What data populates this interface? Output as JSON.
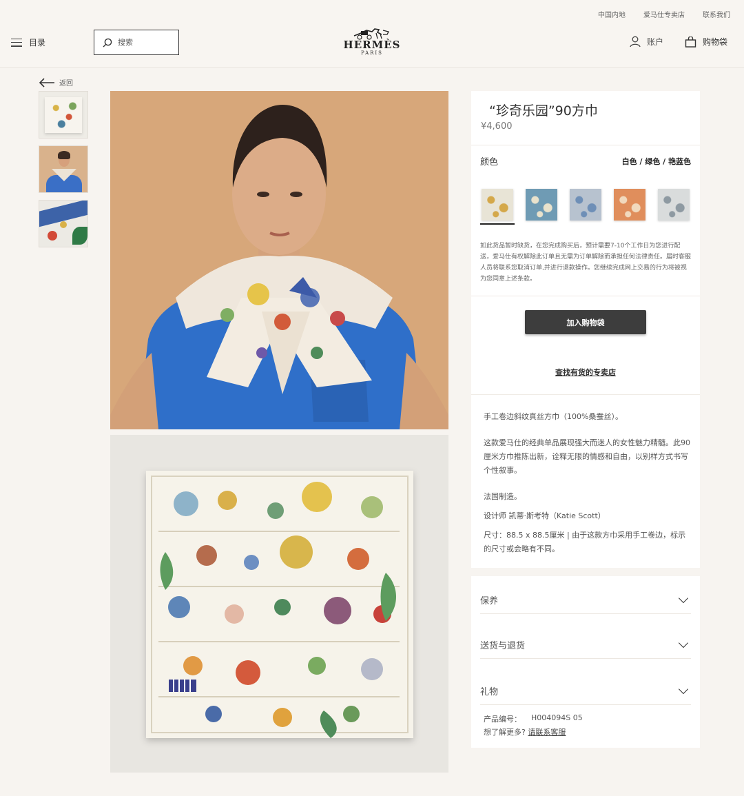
{
  "header": {
    "util_links": [
      "中国内地",
      "爱马仕专卖店",
      "联系我们"
    ],
    "menu_label": "目录",
    "search_placeholder": "搜索",
    "brand": "HERMÈS",
    "brand_city": "PARIS",
    "account_label": "账户",
    "bag_label": "购物袋"
  },
  "nav": {
    "back_label": "返回"
  },
  "product": {
    "title": "“珍奇乐园”90方巾",
    "price": "¥4,600",
    "color_label": "颜色",
    "color_value": "白色 / 绿色 / 艳蓝色",
    "swatches": [
      {
        "name": "白色 / 绿色 / 艳蓝色",
        "color": "#e8e4d6",
        "accent": "#d4a84a",
        "active": true
      },
      {
        "name": "swatch-2",
        "color": "#6f9bb4",
        "accent": "#e9e2cc",
        "active": false
      },
      {
        "name": "swatch-3",
        "color": "#b7c2cf",
        "accent": "#6e8fb7",
        "active": false
      },
      {
        "name": "swatch-4",
        "color": "#e08e5c",
        "accent": "#f1d9bd",
        "active": false
      },
      {
        "name": "swatch-5",
        "color": "#d9dcdc",
        "accent": "#8e9aa2",
        "active": false
      }
    ],
    "notice": "如此货品暂时缺货，在您完成购买后，预计需要7-10个工作日为您进行配送，爱马仕有权解除此订单且无需为订单解除而承担任何法律责任。届时客服人员将联系您取消订单,并进行退款操作。您继续完成网上交易的行为将被视为您同意上述条款。",
    "add_to_bag": "加入购物袋",
    "find_store": "查找有货的专卖店"
  },
  "description": {
    "material": "手工卷边斜纹真丝方巾（100%桑蚕丝）。",
    "body": "这款爱马仕的经典单品展现强大而迷人的女性魅力精髓。此90厘米方巾推陈出新，诠释无限的情感和自由，以别样方式书写个性叙事。",
    "origin": "法国制造。",
    "designer": "设计师 凯蒂·斯考特（Katie Scott）",
    "size": "尺寸：88.5 x 88.5厘米 | 由于这款方巾采用手工卷边，标示的尺寸或会略有不同。"
  },
  "accordion": {
    "items": [
      "保养",
      "送货与退货",
      "礼物"
    ],
    "product_number_label": "产品编号：",
    "product_number": "H004094S 05",
    "help_text": "想了解更多?",
    "help_link": "请联系客服"
  }
}
